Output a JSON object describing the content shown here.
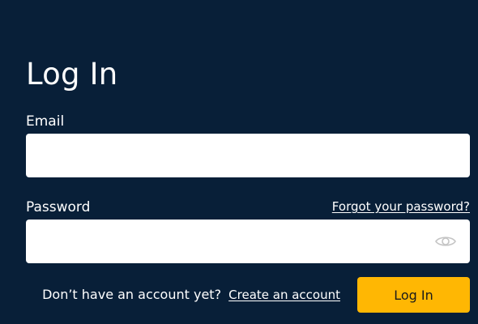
{
  "page": {
    "title": "Log In",
    "background_color": "#081f38"
  },
  "email": {
    "label": "Email",
    "value": "",
    "placeholder": ""
  },
  "password": {
    "label": "Password",
    "value": "",
    "placeholder": "",
    "forgot_link": "Forgot your password?",
    "toggle_icon": "eye-icon"
  },
  "footer": {
    "prompt": "Don’t have an account yet?",
    "create_link": "Create an account",
    "login_button": "Log In",
    "button_color": "#ffb703"
  }
}
